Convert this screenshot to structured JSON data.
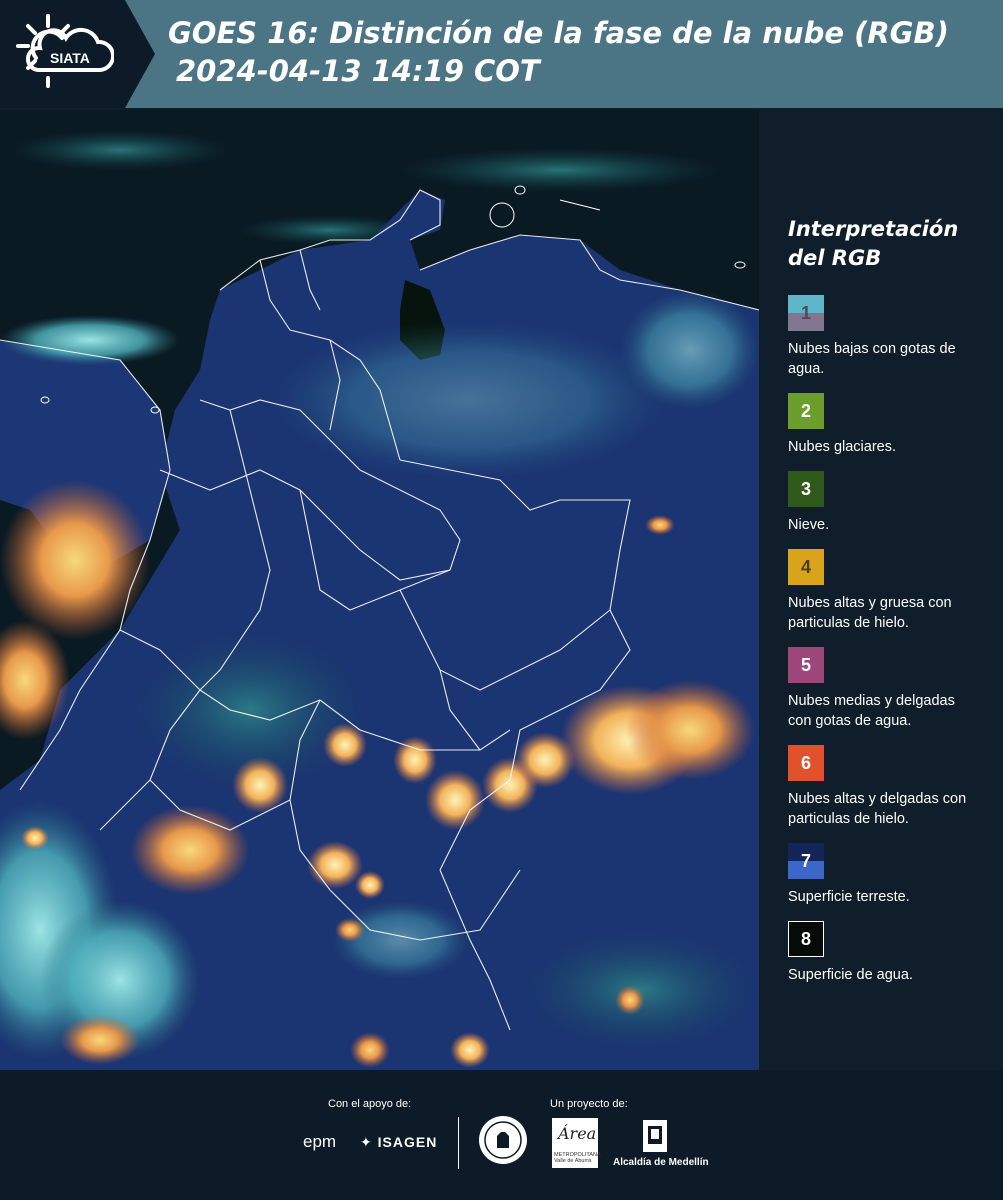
{
  "header": {
    "logo_text": "SIATA",
    "title_line1": "GOES 16: Distinción de la fase de la nube (RGB)",
    "title_line2": "2024-04-13 14:19 COT"
  },
  "legend": {
    "title_line1": "Interpretación",
    "title_line2": "del RGB",
    "items": [
      {
        "num": "1",
        "label": "Nubes bajas con gotas de agua.",
        "color": "#5fb6c8",
        "color2": "#827791"
      },
      {
        "num": "2",
        "label": "Nubes glaciares.",
        "color": "#6d9d2d"
      },
      {
        "num": "3",
        "label": "Nieve.",
        "color": "#2f5a1b"
      },
      {
        "num": "4",
        "label": "Nubes altas y gruesa con particulas de hielo.",
        "color": "#d9a31c"
      },
      {
        "num": "5",
        "label": "Nubes medias y delgadas con gotas de agua.",
        "color": "#9c467a"
      },
      {
        "num": "6",
        "label": "Nubes altas y delgadas con particulas de hielo.",
        "color": "#e0512c"
      },
      {
        "num": "7",
        "label": "Superficie terreste.",
        "color": "#132558",
        "color2": "#3c67c6"
      },
      {
        "num": "8",
        "label": "Superficie de agua.",
        "color": "#050b06"
      }
    ]
  },
  "footer": {
    "support_label": "Con el apoyo de:",
    "project_label": "Un proyecto de:",
    "sponsor_epm": "epm",
    "sponsor_isagen": "ISAGEN",
    "area_logo_text": "Área",
    "area_logo_sub": "METROPOLITANA Valle de Aburrá",
    "alcaldia": "Alcaldía de Medellín"
  },
  "map": {
    "description_icon": "satellite-rgb-image",
    "water_color": "#0a1a22",
    "land_color": "#1b3472",
    "border_color": "#ffffff"
  }
}
